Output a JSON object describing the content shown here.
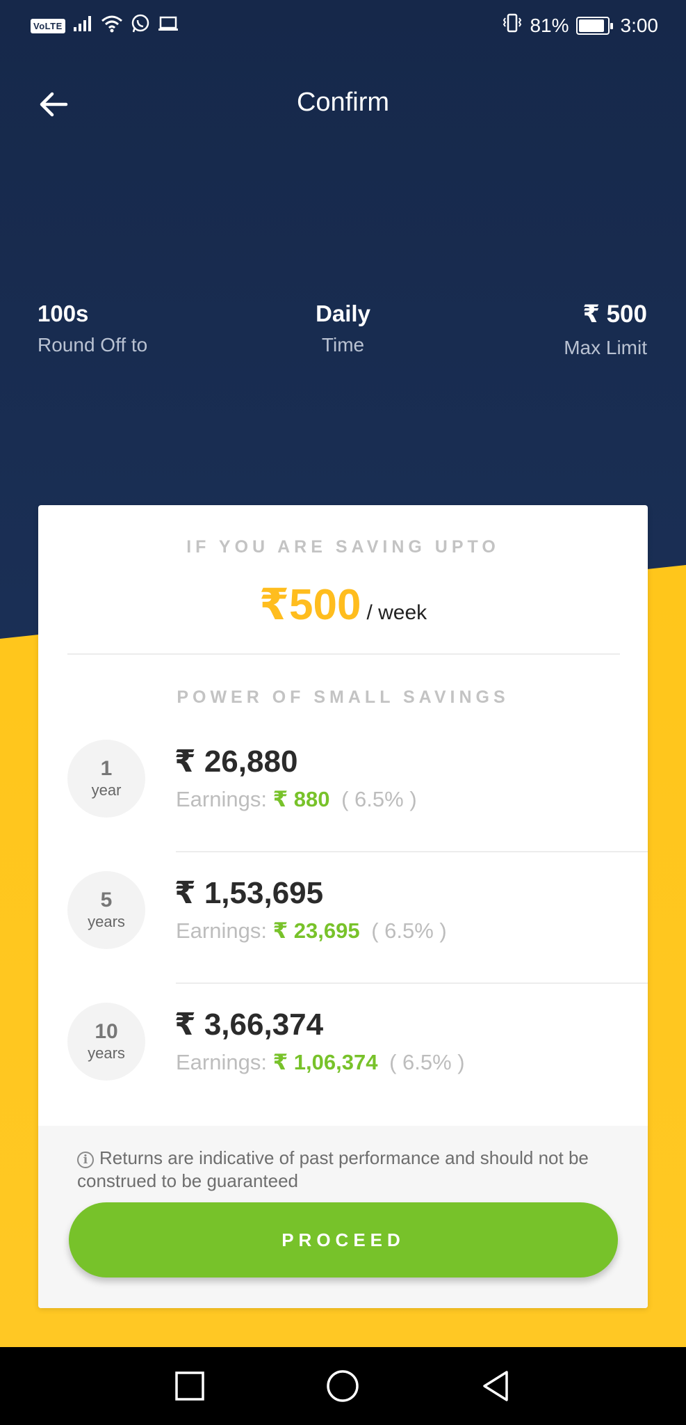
{
  "status_bar": {
    "volte": "VoLTE",
    "battery_percent": "81%",
    "time": "3:00"
  },
  "header": {
    "title": "Confirm",
    "back_icon": "arrow-left-icon"
  },
  "stats": [
    {
      "value": "100s",
      "label": "Round Off to"
    },
    {
      "value": "Daily",
      "label": "Time"
    },
    {
      "value": "₹ 500",
      "label": "Max Limit"
    }
  ],
  "card": {
    "saving_caption": "IF YOU ARE SAVING UPTO",
    "saving_amount": "₹500",
    "saving_period": "/ week",
    "power_caption": "POWER OF SMALL SAVINGS",
    "earnings_label": "Earnings:",
    "rows": [
      {
        "n": "1",
        "unit": "year",
        "total": "₹ 26,880",
        "earnings": "₹ 880",
        "rate": "( 6.5% )"
      },
      {
        "n": "5",
        "unit": "years",
        "total": "₹ 1,53,695",
        "earnings": "₹ 23,695",
        "rate": "( 6.5% )"
      },
      {
        "n": "10",
        "unit": "years",
        "total": "₹ 3,66,374",
        "earnings": "₹ 1,06,374",
        "rate": "( 6.5% )"
      }
    ],
    "disclaimer": "Returns are indicative of past performance and should not be construed to be guaranteed",
    "proceed_label": "PROCEED"
  },
  "colors": {
    "navy": "#1a2f55",
    "yellow": "#ffc414",
    "green": "#77c22a",
    "amount_yellow": "#ffbd1e"
  }
}
